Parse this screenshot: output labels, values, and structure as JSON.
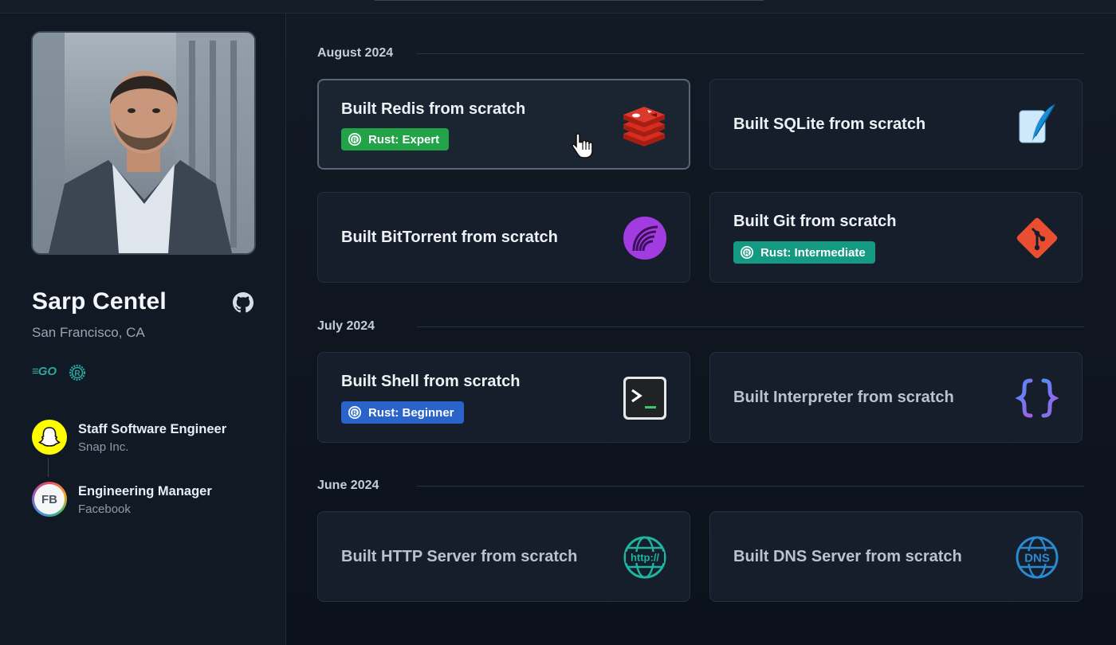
{
  "profile": {
    "name": "Sarp Centel",
    "location": "San Francisco, CA",
    "languages": [
      {
        "name": "GO",
        "icon": "go-icon"
      },
      {
        "name": "Rust",
        "icon": "rust-icon"
      }
    ],
    "jobs": [
      {
        "title": "Staff Software Engineer",
        "company": "Snap Inc.",
        "logo": "snapchat-logo"
      },
      {
        "title": "Engineering Manager",
        "company": "Facebook",
        "logo_text": "FB"
      }
    ]
  },
  "sections": [
    {
      "label": "August 2024",
      "cards": [
        {
          "title": "Built Redis from scratch",
          "badge": "Rust: Expert",
          "badge_color": "#22a347",
          "icon": "redis-icon",
          "state": "hovered"
        },
        {
          "title": "Built SQLite from scratch",
          "icon": "sqlite-icon"
        },
        {
          "title": "Built BitTorrent from scratch",
          "icon": "bittorrent-icon"
        },
        {
          "title": "Built Git from scratch",
          "badge": "Rust: Intermediate",
          "badge_color": "#149a82",
          "icon": "git-icon"
        }
      ]
    },
    {
      "label": "July 2024",
      "cards": [
        {
          "title": "Built Shell from scratch",
          "badge": "Rust: Beginner",
          "badge_color": "#2a63c9",
          "icon": "terminal-icon"
        },
        {
          "title": "Built Interpreter from scratch",
          "icon": "braces-icon"
        }
      ]
    },
    {
      "label": "June 2024",
      "cards": [
        {
          "title": "Built HTTP Server from scratch",
          "icon": "http-globe-icon",
          "icon_text": "http://"
        },
        {
          "title": "Built DNS Server from scratch",
          "icon": "dns-globe-icon",
          "icon_text": "DNS"
        }
      ]
    }
  ],
  "colors": {
    "background": "#0f1620",
    "card": "#151e2a",
    "accent_green": "#22a347",
    "accent_teal": "#149a82",
    "accent_blue": "#2a63c9"
  }
}
